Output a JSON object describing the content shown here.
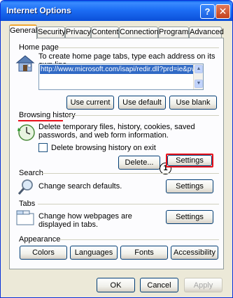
{
  "window": {
    "title": "Internet Options",
    "help_glyph": "?",
    "close_glyph": "✕"
  },
  "tabs": [
    {
      "label": "General"
    },
    {
      "label": "Security"
    },
    {
      "label": "Privacy"
    },
    {
      "label": "Content"
    },
    {
      "label": "Connections"
    },
    {
      "label": "Programs"
    },
    {
      "label": "Advanced"
    }
  ],
  "home_page": {
    "title": "Home page",
    "description": "To create home page tabs, type each address on its own line.",
    "url": "http://www.microsoft.com/isapi/redir.dll?prd=ie&pver=",
    "buttons": {
      "use_current": "Use current",
      "use_default": "Use default",
      "use_blank": "Use blank"
    }
  },
  "browsing_history": {
    "title": "Browsing history",
    "description": "Delete temporary files, history, cookies, saved passwords, and web form information.",
    "checkbox_label": "Delete browsing history on exit",
    "delete_button": "Delete...",
    "settings_button": "Settings",
    "step_badge": "1",
    "highlight_color": "#e8101a"
  },
  "search": {
    "title": "Search",
    "description": "Change search defaults.",
    "settings_button": "Settings"
  },
  "tabs_section": {
    "title": "Tabs",
    "description": "Change how webpages are displayed in tabs.",
    "settings_button": "Settings"
  },
  "appearance": {
    "title": "Appearance",
    "buttons": {
      "colors": "Colors",
      "languages": "Languages",
      "fonts": "Fonts",
      "accessibility": "Accessibility"
    }
  },
  "footer": {
    "ok": "OK",
    "cancel": "Cancel",
    "apply": "Apply"
  },
  "colors": {
    "titlebar": "#0a5fe8",
    "dialog_bg": "#ece9d8",
    "selection": "#316ac5"
  }
}
